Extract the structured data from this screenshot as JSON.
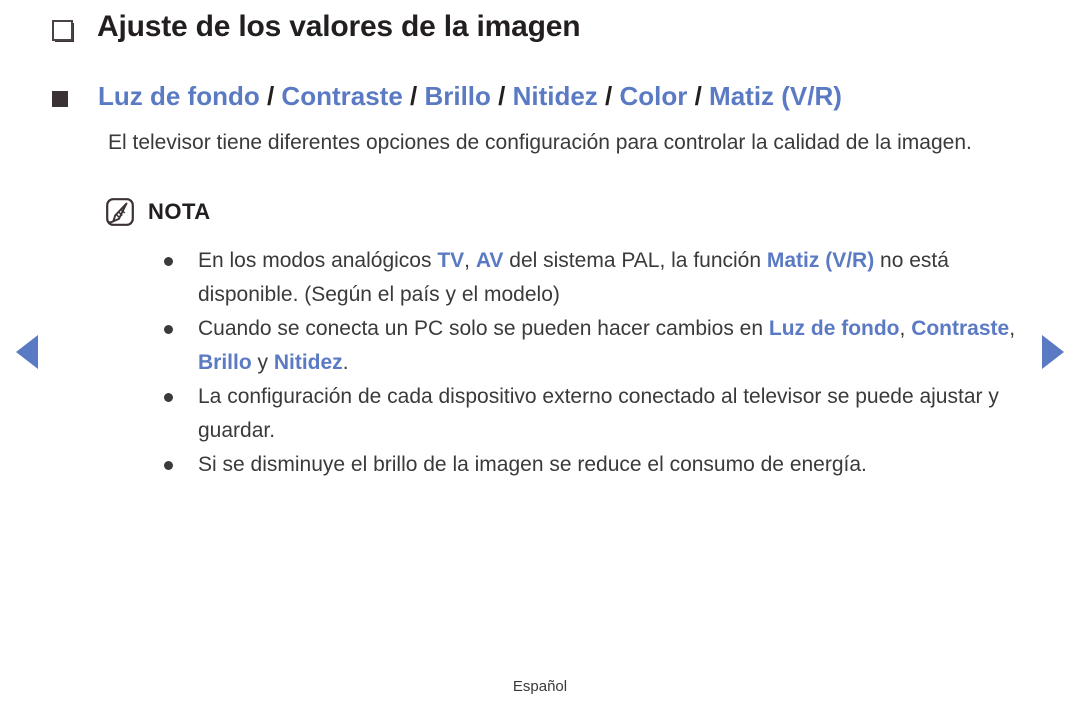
{
  "document": {
    "title": "Ajuste de los valores de la imagen",
    "subheading": {
      "items": [
        "Luz de fondo",
        "Contraste",
        "Brillo",
        "Nitidez",
        "Color",
        "Matiz (V/R)"
      ],
      "separator": "/"
    },
    "body_paragraph": "El televisor tiene diferentes opciones de configuración para controlar la calidad de la imagen.",
    "note": {
      "label": "NOTA",
      "items": [
        {
          "segments": [
            {
              "text": "En los modos analógicos ",
              "style": "normal"
            },
            {
              "text": "TV",
              "style": "blue-bold"
            },
            {
              "text": ", ",
              "style": "normal"
            },
            {
              "text": "AV",
              "style": "blue-bold"
            },
            {
              "text": " del sistema PAL, la función ",
              "style": "normal"
            },
            {
              "text": "Matiz (V/R)",
              "style": "blue-bold"
            },
            {
              "text": " no está disponible. (Según el país y el modelo)",
              "style": "normal"
            }
          ]
        },
        {
          "segments": [
            {
              "text": "Cuando se conecta un PC solo se pueden hacer cambios en ",
              "style": "normal"
            },
            {
              "text": "Luz de fondo",
              "style": "blue-bold"
            },
            {
              "text": ", ",
              "style": "normal"
            },
            {
              "text": "Contraste",
              "style": "blue-bold"
            },
            {
              "text": ", ",
              "style": "normal"
            },
            {
              "text": "Brillo",
              "style": "blue-bold"
            },
            {
              "text": " y ",
              "style": "normal"
            },
            {
              "text": "Nitidez",
              "style": "blue-bold"
            },
            {
              "text": ".",
              "style": "normal"
            }
          ]
        },
        {
          "segments": [
            {
              "text": "La configuración de cada dispositivo externo conectado al televisor se puede ajustar y guardar.",
              "style": "normal"
            }
          ]
        },
        {
          "segments": [
            {
              "text": "Si se disminuye el brillo de la imagen se reduce el consumo de energía.",
              "style": "normal"
            }
          ]
        }
      ]
    },
    "footer": "Español"
  },
  "navigation": {
    "previous_label": "◀",
    "next_label": "▶"
  },
  "colors": {
    "accent_blue": "#5b7ac4",
    "text_dark": "#3a3a3a",
    "title_dark": "#231f20"
  }
}
